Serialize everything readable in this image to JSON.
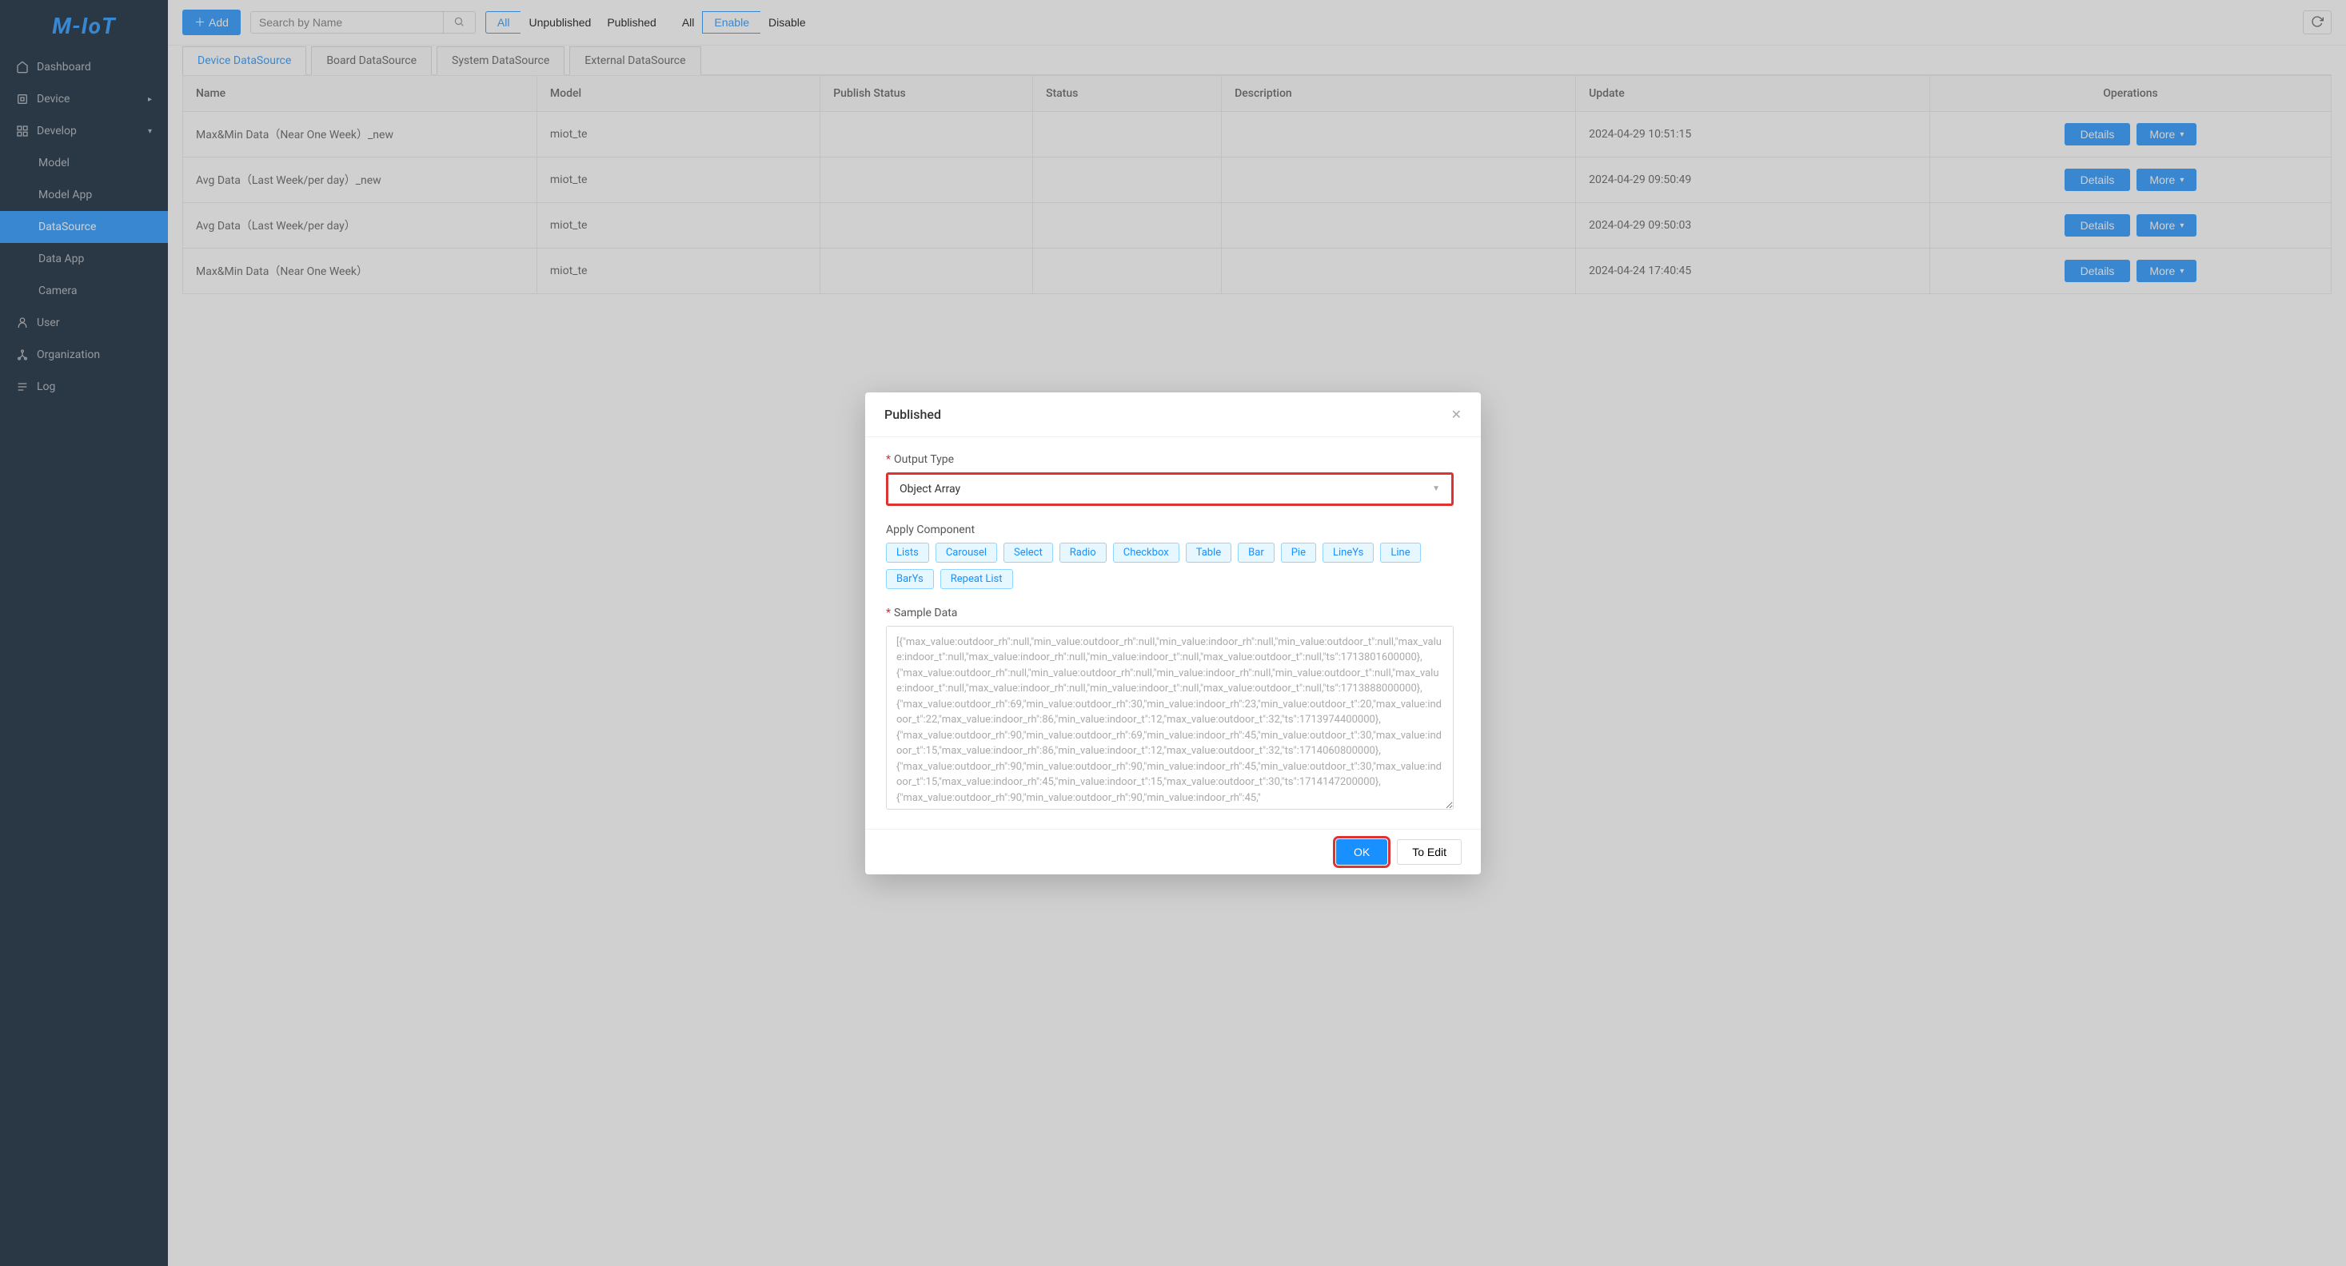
{
  "brand": "M-IoT",
  "sidebar": {
    "items": [
      {
        "label": "Dashboard",
        "icon": "home"
      },
      {
        "label": "Device",
        "icon": "chip",
        "expandable": true
      },
      {
        "label": "Develop",
        "icon": "grid",
        "expandable": true,
        "expanded": true,
        "children": [
          {
            "label": "Model"
          },
          {
            "label": "Model App"
          },
          {
            "label": "DataSource",
            "selected": true
          },
          {
            "label": "Data App"
          },
          {
            "label": "Camera"
          }
        ]
      },
      {
        "label": "User",
        "icon": "user"
      },
      {
        "label": "Organization",
        "icon": "org"
      },
      {
        "label": "Log",
        "icon": "log"
      }
    ]
  },
  "topbar": {
    "add_label": "Add",
    "search_placeholder": "Search by Name",
    "filter1": {
      "all": "All",
      "unpublished": "Unpublished",
      "published": "Published"
    },
    "filter2": {
      "all": "All",
      "enable": "Enable",
      "disable": "Disable"
    }
  },
  "tabs": [
    {
      "label": "Device DataSource",
      "active": true
    },
    {
      "label": "Board DataSource"
    },
    {
      "label": "System DataSource"
    },
    {
      "label": "External DataSource"
    }
  ],
  "table": {
    "columns": [
      "Name",
      "Model",
      "Publish Status",
      "Status",
      "Description",
      "Update",
      "Operations"
    ],
    "op_details": "Details",
    "op_more": "More",
    "rows": [
      {
        "name": "Max&Min Data（Near One Week）_new",
        "model": "miot_te",
        "update": "2024-04-29 10:51:15"
      },
      {
        "name": "Avg Data（Last Week/per day）_new",
        "model": "miot_te",
        "update": "2024-04-29 09:50:49"
      },
      {
        "name": "Avg Data（Last Week/per day）",
        "model": "miot_te",
        "update": "2024-04-29 09:50:03"
      },
      {
        "name": "Max&Min Data（Near One Week）",
        "model": "miot_te",
        "update": "2024-04-24 17:40:45"
      }
    ]
  },
  "modal": {
    "title": "Published",
    "output_type_label": "Output Type",
    "output_type_value": "Object Array",
    "apply_component_label": "Apply Component",
    "components": [
      "Lists",
      "Carousel",
      "Select",
      "Radio",
      "Checkbox",
      "Table",
      "Bar",
      "Pie",
      "LineYs",
      "Line",
      "BarYs",
      "Repeat List"
    ],
    "sample_data_label": "Sample Data",
    "sample_data_value": "[{\"max_value:outdoor_rh\":null,\"min_value:outdoor_rh\":null,\"min_value:indoor_rh\":null,\"min_value:outdoor_t\":null,\"max_value:indoor_t\":null,\"max_value:indoor_rh\":null,\"min_value:indoor_t\":null,\"max_value:outdoor_t\":null,\"ts\":1713801600000},{\"max_value:outdoor_rh\":null,\"min_value:outdoor_rh\":null,\"min_value:indoor_rh\":null,\"min_value:outdoor_t\":null,\"max_value:indoor_t\":null,\"max_value:indoor_rh\":null,\"min_value:indoor_t\":null,\"max_value:outdoor_t\":null,\"ts\":1713888000000},{\"max_value:outdoor_rh\":69,\"min_value:outdoor_rh\":30,\"min_value:indoor_rh\":23,\"min_value:outdoor_t\":20,\"max_value:indoor_t\":22,\"max_value:indoor_rh\":86,\"min_value:indoor_t\":12,\"max_value:outdoor_t\":32,\"ts\":1713974400000},{\"max_value:outdoor_rh\":90,\"min_value:outdoor_rh\":69,\"min_value:indoor_rh\":45,\"min_value:outdoor_t\":30,\"max_value:indoor_t\":15,\"max_value:indoor_rh\":86,\"min_value:indoor_t\":12,\"max_value:outdoor_t\":32,\"ts\":1714060800000},{\"max_value:outdoor_rh\":90,\"min_value:outdoor_rh\":90,\"min_value:indoor_rh\":45,\"min_value:outdoor_t\":30,\"max_value:indoor_t\":15,\"max_value:indoor_rh\":45,\"min_value:indoor_t\":15,\"max_value:outdoor_t\":30,\"ts\":1714147200000},{\"max_value:outdoor_rh\":90,\"min_value:outdoor_rh\":90,\"min_value:indoor_rh\":45,\"",
    "ok_label": "OK",
    "toedit_label": "To Edit"
  }
}
